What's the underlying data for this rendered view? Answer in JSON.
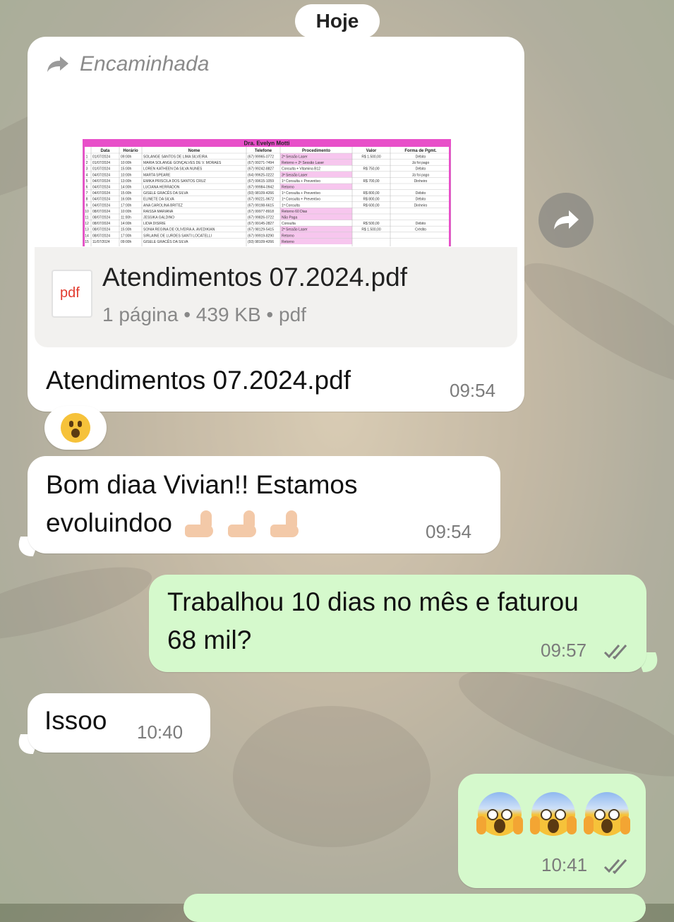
{
  "date_separator": "Hoje",
  "messages": {
    "forwarded_doc": {
      "forwarded_label": "Encaminhada",
      "preview": {
        "title": "Dra. Evelyn Motti",
        "headers": [
          "Data",
          "Horário",
          "Nome",
          "Telefone",
          "Procedimento",
          "Valor",
          "Forma de Pgmt."
        ],
        "rows": [
          [
            "1",
            "01/07/2024",
            "09:00h",
            "SOLANGE SANTOS DE LIMA SILVEIRA",
            "(67) 99965-0772",
            "2ª Sessão Laser",
            "R$ 1.500,00",
            "Débito"
          ],
          [
            "2",
            "01/07/2024",
            "10:00h",
            "MARIA SOLANGE GONÇALVES DE V. MORAES",
            "(67) 99271-7494",
            "Retorno + 2ª Sessão Laser",
            "",
            "Já foi pago"
          ],
          [
            "3",
            "01/07/2024",
            "15:00h",
            "LOREN KATHEEN DA SILVA NUNES",
            "(67) 99242-8827",
            "Consulta + Vitamina B12",
            "R$ 750,00",
            "Débito"
          ],
          [
            "4",
            "04/07/2024",
            "10:00h",
            "MARTA SPEARE",
            "(64) 99625-0222",
            "3ª Sessão Laser",
            "",
            "Já foi pago"
          ],
          [
            "5",
            "04/07/2024",
            "13:00h",
            "EMIKA PRISCILA DOS SANTOS CRUZ",
            "(67) 99615-1059",
            "1ª Consulta + Preventivo",
            "R$ 700,00",
            "Dinheiro"
          ],
          [
            "6",
            "04/07/2024",
            "14:00h",
            "LUCIANA HERRADON",
            "(67) 99984-0942",
            "Retorno",
            "",
            ""
          ],
          [
            "7",
            "04/07/2024",
            "15:00h",
            "GISELE GRACÊS DA SILVA",
            "(93) 98109-4266",
            "1ª Consulta + Preventivo",
            "R$ 800,00",
            "Débito"
          ],
          [
            "8",
            "04/07/2024",
            "16:00h",
            "ELINETE DA SILVA",
            "(67) 99221-9672",
            "1ª Consulta + Preventivo",
            "R$ 800,00",
            "Débito"
          ],
          [
            "9",
            "04/07/2024",
            "17:00h",
            "ANA CAROLINA BRITEZ",
            "(67) 99198-6615",
            "1ª Consulta",
            "R$ 600,00",
            "Dinheiro"
          ],
          [
            "10",
            "08/07/2024",
            "10:00h",
            "RAISSA MARIANA",
            "(67) 99977-8918",
            "Retorno 60 Dias",
            "",
            ""
          ],
          [
            "11",
            "08/07/2024",
            "11:00h",
            "JESSIKA GALDINO",
            "(67) 99826-0722",
            "Não Paga",
            "",
            ""
          ],
          [
            "12",
            "08/07/2024",
            "14:00h",
            "LIDIA DISIRIE",
            "(67) 99145-2827",
            "Consulta",
            "R$ 500,00",
            "Débito"
          ],
          [
            "13",
            "08/07/2024",
            "15:00h",
            "SONIA REGINA DE OLIVEIRA A. AVEDIKIAN",
            "(67) 98129-5415",
            "2ª Sessão Laser",
            "R$ 1.500,00",
            "Crédito"
          ],
          [
            "14",
            "08/07/2024",
            "17:00h",
            "SIRLAINE DE LURDES SANTI LOCATELLI",
            "(67) 99919-8290",
            "Retorno",
            "",
            ""
          ],
          [
            "15",
            "11/07/2024",
            "09:00h",
            "GISELE GRACÊS DA SILVA",
            "(93) 98109-4266",
            "Retorno",
            "",
            ""
          ]
        ]
      },
      "file_icon_label": "pdf",
      "file_name": "Atendimentos 07.2024.pdf",
      "file_meta": "1 página • 439 KB • pdf",
      "caption": "Atendimentos 07.2024.pdf",
      "time": "09:54",
      "reaction": "astonished-face"
    },
    "msg2": {
      "line1": "Bom diaa Vivian!! Estamos",
      "line2": "evoluindoo",
      "emoji": "flexed-biceps x3",
      "time": "09:54"
    },
    "msg3": {
      "line1": "Trabalhou 10 dias no mês e faturou",
      "line2": "68 mil?",
      "time": "09:57"
    },
    "msg4": {
      "text": "Issoo",
      "time": "10:40"
    },
    "msg5": {
      "emoji": "face-screaming-in-fear x3",
      "time": "10:41"
    }
  },
  "colors": {
    "incoming": "#ffffff",
    "outgoing": "#d5f9cc",
    "read_ticks": "#7b7b7b"
  }
}
